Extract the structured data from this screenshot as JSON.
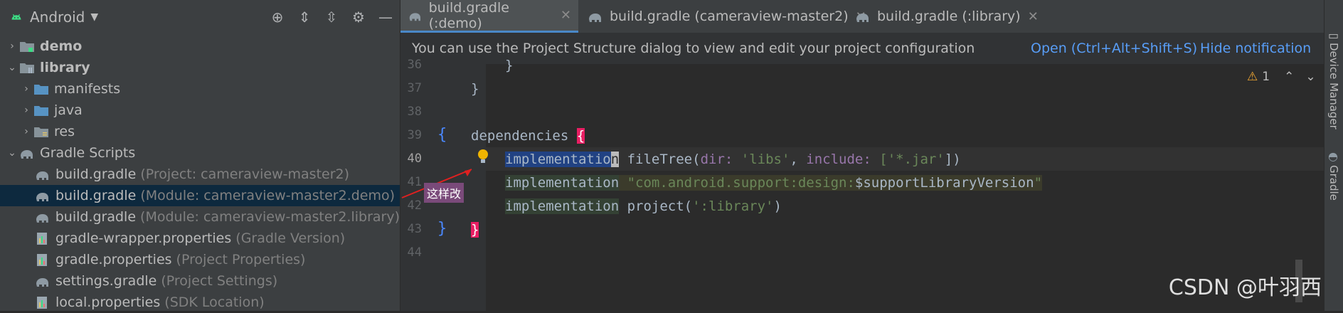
{
  "project_panel": {
    "title": "Android",
    "toolbar": [
      "crosshair-icon",
      "expand-all-icon",
      "collapse-all-icon",
      "gear-icon",
      "minimize-icon"
    ],
    "tree": [
      {
        "label": "demo",
        "bold": true,
        "hint": "",
        "expanded": false,
        "icon": "module-folder-icon"
      },
      {
        "label": "library",
        "bold": true,
        "hint": "",
        "expanded": true,
        "icon": "library-folder-icon"
      },
      {
        "label": "manifests",
        "bold": false,
        "hint": "",
        "expanded": false,
        "icon": "folder-icon"
      },
      {
        "label": "java",
        "bold": false,
        "hint": "",
        "expanded": false,
        "icon": "folder-icon"
      },
      {
        "label": "res",
        "bold": false,
        "hint": "",
        "expanded": false,
        "icon": "res-folder-icon"
      },
      {
        "label": "Gradle Scripts",
        "bold": false,
        "hint": "",
        "expanded": true,
        "icon": "gradle-icon"
      },
      {
        "label": "build.gradle",
        "bold": false,
        "hint": "(Project: cameraview-master2)",
        "icon": "gradle-icon"
      },
      {
        "label": "build.gradle",
        "bold": false,
        "hint": "(Module: cameraview-master2.demo)",
        "icon": "gradle-icon",
        "selected": true
      },
      {
        "label": "build.gradle",
        "bold": false,
        "hint": "(Module: cameraview-master2.library)",
        "icon": "gradle-icon"
      },
      {
        "label": "gradle-wrapper.properties",
        "bold": false,
        "hint": "(Gradle Version)",
        "icon": "properties-icon"
      },
      {
        "label": "gradle.properties",
        "bold": false,
        "hint": "(Project Properties)",
        "icon": "properties-icon"
      },
      {
        "label": "settings.gradle",
        "bold": false,
        "hint": "(Project Settings)",
        "icon": "gradle-icon"
      },
      {
        "label": "local.properties",
        "bold": false,
        "hint": "(SDK Location)",
        "icon": "properties-icon"
      }
    ]
  },
  "tabs": [
    {
      "label": "build.gradle (:demo)",
      "active": true
    },
    {
      "label": "build.gradle (cameraview-master2)",
      "active": false
    },
    {
      "label": "build.gradle (:library)",
      "active": false
    }
  ],
  "notification": {
    "message": "You can use the Project Structure dialog to view and edit your project configuration",
    "open_link": "Open (Ctrl+Alt+Shift+S)",
    "hide_link": "Hide notification"
  },
  "editor": {
    "line_numbers": [
      "36",
      "37",
      "38",
      "39",
      "40",
      "41",
      "42",
      "43",
      "44"
    ],
    "warning_count": "1",
    "code": {
      "l36": "}",
      "l37": "}",
      "l39_kw": "dependencies",
      "l39_brace": "{",
      "l40_impl": "implementatio",
      "l40_impl_caret": "n",
      "l40_rest_a": " fileTree(",
      "l40_p1": "dir:",
      "l40_s1": " 'libs'",
      "l40_comma": ", ",
      "l40_p2": "include:",
      "l40_s2": " ['*.jar'",
      "l40_end": "])",
      "l41_impl": "implementation",
      "l41_str": " \"com.android.support:design:",
      "l41_var": "$supportLibraryVersion",
      "l41_strend": "\"",
      "l42_impl": "implementation",
      "l42_rest": " project(",
      "l42_str": "':library'",
      "l42_end": ")",
      "l43_brace": "}"
    }
  },
  "annotation": "这样改",
  "side_tools": [
    "Device Manager",
    "Gradle"
  ],
  "watermark": "CSDN @叶羽西"
}
